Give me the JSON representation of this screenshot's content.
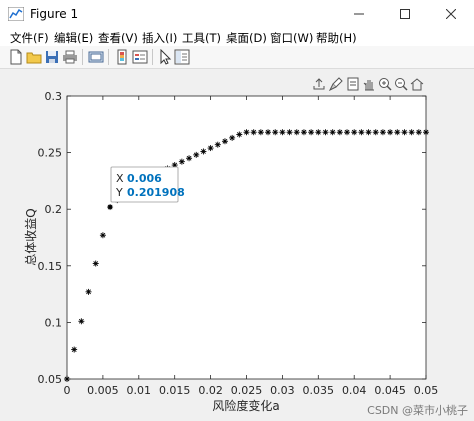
{
  "window": {
    "title": "Figure 1"
  },
  "menu": [
    "文件(F)",
    "编辑(E)",
    "查看(V)",
    "插入(I)",
    "工具(T)",
    "桌面(D)",
    "窗口(W)",
    "帮助(H)"
  ],
  "toolbar_icons": [
    "new-figure-icon",
    "open-file-icon",
    "save-icon",
    "print-icon",
    "link-plot-icon",
    "colorbar-icon",
    "legend-icon",
    "edit-plot-icon",
    "property-inspector-icon"
  ],
  "axes_toolbar_icons": [
    "export-icon",
    "brush-icon",
    "datatip-icon",
    "pan-icon",
    "zoom-in-icon",
    "zoom-out-icon",
    "home-icon"
  ],
  "datatip": {
    "x_label": "X",
    "x_value": "0.006",
    "y_label": "Y",
    "y_value": "0.201908"
  },
  "watermark": "CSDN @菜市小桃子",
  "chart_data": {
    "type": "scatter",
    "marker": "*",
    "color": "#000000",
    "xlabel": "风险度变化a",
    "ylabel": "总体收益Q",
    "xlim": [
      0,
      0.05
    ],
    "ylim": [
      0.05,
      0.3
    ],
    "xticks": [
      "0",
      "0.005",
      "0.01",
      "0.015",
      "0.02",
      "0.025",
      "0.03",
      "0.035",
      "0.04",
      "0.045",
      "0.05"
    ],
    "yticks": [
      "0.05",
      "0.1",
      "0.15",
      "0.2",
      "0.25",
      "0.3"
    ],
    "series": [
      {
        "x": [
          0,
          0.001,
          0.002,
          0.003,
          0.004,
          0.005,
          0.006,
          0.007,
          0.008,
          0.009,
          0.01,
          0.011,
          0.012,
          0.013,
          0.014,
          0.015,
          0.016,
          0.017,
          0.018,
          0.019,
          0.02,
          0.021,
          0.022,
          0.023,
          0.024,
          0.025,
          0.026,
          0.027,
          0.028,
          0.029,
          0.03,
          0.031,
          0.032,
          0.033,
          0.034,
          0.035,
          0.036,
          0.037,
          0.038,
          0.039,
          0.04,
          0.041,
          0.042,
          0.043,
          0.044,
          0.045,
          0.046,
          0.047,
          0.048,
          0.049,
          0.05
        ],
        "y": [
          0.05,
          0.076,
          0.101,
          0.127,
          0.152,
          0.177,
          0.2019,
          0.208,
          0.213,
          0.218,
          0.222,
          0.226,
          0.23,
          0.233,
          0.236,
          0.239,
          0.242,
          0.245,
          0.248,
          0.251,
          0.254,
          0.257,
          0.26,
          0.263,
          0.266,
          0.268,
          0.268,
          0.268,
          0.268,
          0.268,
          0.268,
          0.268,
          0.268,
          0.268,
          0.268,
          0.268,
          0.268,
          0.268,
          0.268,
          0.268,
          0.268,
          0.268,
          0.268,
          0.268,
          0.268,
          0.268,
          0.268,
          0.268,
          0.268,
          0.268,
          0.268
        ]
      }
    ]
  }
}
